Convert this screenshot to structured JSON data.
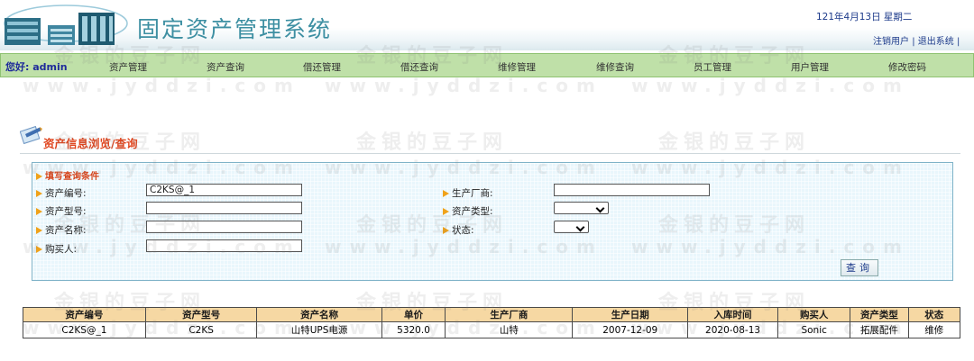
{
  "header": {
    "title": "固定资产管理系统",
    "date": "121年4月13日 星期二",
    "logout_user": "注销用户",
    "separator": "|",
    "exit_system": "退出系统",
    "trailing_sep": "|"
  },
  "nav": {
    "welcome_prefix": "您好:",
    "username": "admin",
    "items": [
      "资产管理",
      "资产查询",
      "借还管理",
      "借还查询",
      "维修管理",
      "维修查询",
      "员工管理",
      "用户管理",
      "修改密码"
    ]
  },
  "section": {
    "title": "资产信息浏览/查询"
  },
  "form": {
    "hint": "填写查询条件",
    "asset_no_label": "资产编号:",
    "asset_no_value": "C2KS@_1",
    "asset_model_label": "资产型号:",
    "asset_model_value": "",
    "asset_name_label": "资产名称:",
    "asset_name_value": "",
    "buyer_label": "购买人:",
    "buyer_value": "",
    "manufacturer_label": "生产厂商:",
    "manufacturer_value": "",
    "asset_type_label": "资产类型:",
    "asset_type_value": "",
    "status_label": "状态:",
    "status_value": "",
    "search_button": "查询"
  },
  "table": {
    "headers": [
      "资产编号",
      "资产型号",
      "资产名称",
      "单价",
      "生产厂商",
      "生产日期",
      "入库时间",
      "购买人",
      "资产类型",
      "状态"
    ],
    "rows": [
      [
        "C2KS@_1",
        "C2KS",
        "山特UPS电源",
        "5320.0",
        "山特",
        "2007-12-09",
        "2020-08-13",
        "Sonic",
        "拓展配件",
        "维修"
      ]
    ]
  },
  "watermark": {
    "cn": "金银的豆子网",
    "url": "www.jyddzi.com"
  },
  "colors": {
    "title": "#3d8fa2",
    "nav_bg": "#bfe0a8",
    "section_title": "#e0451e",
    "panel_bg": "#e9f6fc",
    "table_header_bg": "#f6d8a3"
  }
}
